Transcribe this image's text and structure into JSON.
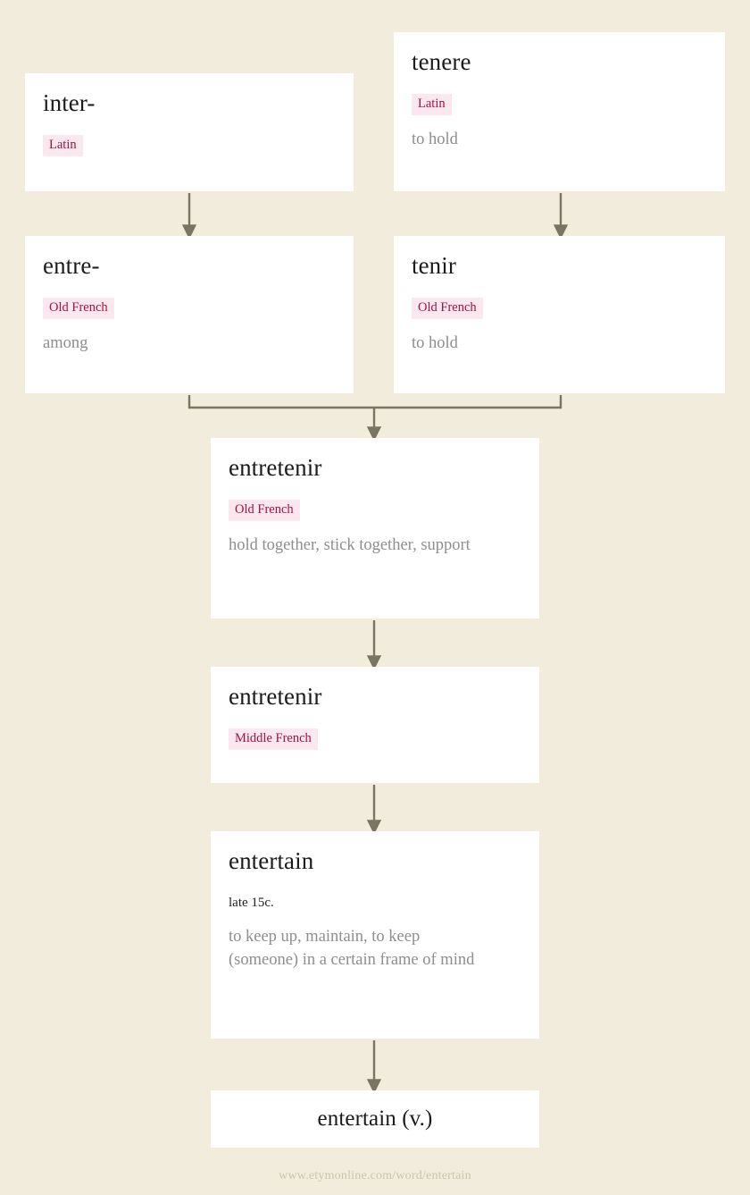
{
  "page": {
    "background_color": "#f2ecdc",
    "box_color": "#ffffff",
    "tag_background": "#fae8ee",
    "tag_color": "#a3123f",
    "gloss_color": "#8e8e8e",
    "arrow_color": "#7a7562",
    "footer_url": "www.etymonline.com/word/entertain"
  },
  "nodes": {
    "inter": {
      "word": "inter-",
      "language": "Latin",
      "gloss": ""
    },
    "tenere": {
      "word": "tenere",
      "language": "Latin",
      "gloss": "to hold"
    },
    "entre": {
      "word": "entre-",
      "language": "Old French",
      "gloss": "among"
    },
    "tenir": {
      "word": "tenir",
      "language": "Old French",
      "gloss": "to hold"
    },
    "entretenir_of": {
      "word": "entretenir",
      "language": "Old French",
      "gloss": "hold together, stick together, support"
    },
    "entretenir_mf": {
      "word": "entretenir",
      "language": "Middle French",
      "gloss": ""
    },
    "entertain": {
      "word": "entertain",
      "date": "late 15c.",
      "gloss": "to keep up, maintain, to keep (someone) in a certain frame of mind"
    },
    "headword": {
      "word": "entertain (v.)"
    }
  }
}
